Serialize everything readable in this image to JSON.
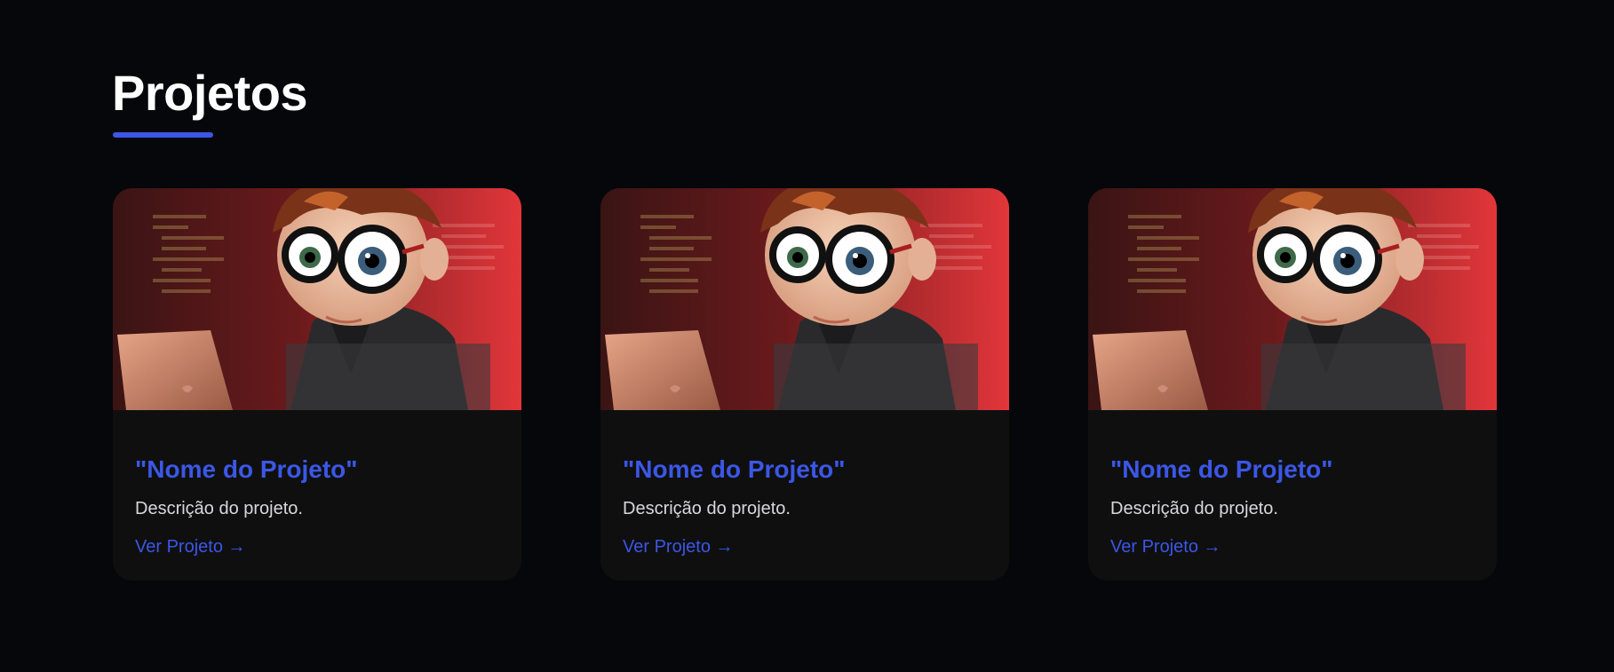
{
  "section": {
    "heading": "Projetos"
  },
  "colors": {
    "accent": "#3b57e6",
    "background": "#06070a",
    "card": "#0f0f10",
    "text": "#d8d8dc"
  },
  "projects": [
    {
      "image": "cartoon-developer-with-glasses-laptop-image",
      "title": "\"Nome do Projeto\"",
      "description": "Descrição do projeto.",
      "link_label": "Ver Projeto →"
    },
    {
      "image": "cartoon-developer-with-glasses-laptop-image",
      "title": "\"Nome do Projeto\"",
      "description": "Descrição do projeto.",
      "link_label": "Ver Projeto →"
    },
    {
      "image": "cartoon-developer-with-glasses-laptop-image",
      "title": "\"Nome do Projeto\"",
      "description": "Descrição do projeto.",
      "link_label": "Ver Projeto →"
    }
  ]
}
